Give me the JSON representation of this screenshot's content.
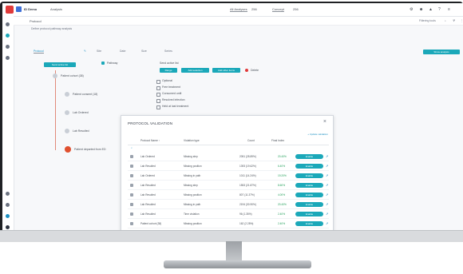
{
  "app": {
    "name": "ID Demo",
    "menu": "Analysis",
    "tabs": [
      "All Analyses",
      "Concept"
    ],
    "tab_counts": [
      "256",
      "256"
    ],
    "subtitle": "Protocol",
    "filter_label": "Filtering tools",
    "breadcrumb": "Define protocol pathway analysis",
    "teal_action": "Show analysis"
  },
  "filters": {
    "protocol_label": "Protocol",
    "col2": "Site",
    "col3": "Date",
    "col4": "Size",
    "col5": "Series",
    "selected_node": "Send active list",
    "dropdown": "Pathway",
    "action_buttons": [
      "Range",
      "Add selection",
      "Add other items"
    ],
    "status": "Delete",
    "checks": [
      "Optional",
      "Free treatment",
      "Consumed until",
      "Resolved infection",
      "Held at last treatment"
    ]
  },
  "tree": {
    "nodes": [
      "Patient cohort (38)",
      "Patient consent (18)",
      "Lab Ordered",
      "Lab Resulted",
      "Patient departed from ED"
    ]
  },
  "popup": {
    "title": "PROTOCOL VALIDATION",
    "link": "+ Update validation",
    "headers": [
      "Protocol Name ↑",
      "Violation type",
      "Count",
      "Final Index"
    ],
    "rows": [
      {
        "name": "Lab Ordered",
        "type": "Missing step",
        "count": "2051 (28.89%)",
        "pct": "20.40%",
        "btn": "Enable"
      },
      {
        "name": "Lab Resulted",
        "type": "Missing position",
        "count": "1393 (19.62%)",
        "pct": "6.40%",
        "btn": "Enable"
      },
      {
        "name": "Lab Ordered",
        "type": "Missing in path",
        "count": "1011 (14.24%)",
        "pct": "19.20%",
        "btn": "Enable"
      },
      {
        "name": "Lab Resulted",
        "type": "Missing step",
        "count": "1553 (21.87%)",
        "pct": "8.60%",
        "btn": "Enable"
      },
      {
        "name": "Lab Resulted",
        "type": "Missing position",
        "count": "807 (11.37%)",
        "pct": "4.00%",
        "btn": "Enable"
      },
      {
        "name": "Lab Resulted",
        "type": "Missing in path",
        "count": "2194 (30.90%)",
        "pct": "20.40%",
        "btn": "Enable"
      },
      {
        "name": "Lab Resulted",
        "type": "Time violation",
        "count": "96 (1.35%)",
        "pct": "2.40%",
        "btn": "Enable"
      },
      {
        "name": "Patient cohort (38)",
        "type": "Missing position",
        "count": "162 (2.28%)",
        "pct": "2.40%",
        "btn": "Enable"
      }
    ]
  },
  "colors": {
    "accent": "#1ba8b9",
    "brand": "#e03a3a",
    "link": "#1b8fc2"
  }
}
